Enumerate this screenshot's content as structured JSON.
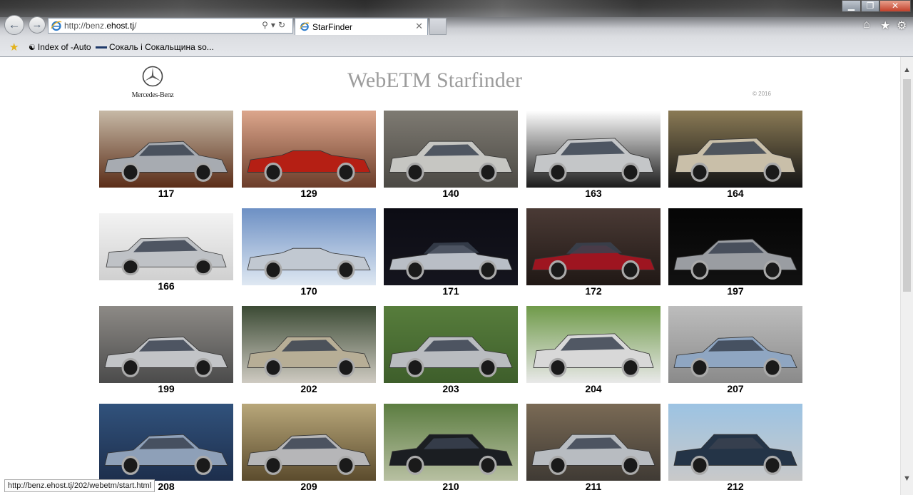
{
  "browser": {
    "address_url_prefix": "http://benz.",
    "address_url_host": "ehost.tj",
    "address_url_suffix": "/",
    "tab_title": "StarFinder",
    "favorites": [
      {
        "label": "Index of -Auto"
      },
      {
        "label": "Сокаль і Сокальщина  so..."
      }
    ],
    "status_url": "http://benz.ehost.tj/202/webetm/start.html"
  },
  "page": {
    "logo_text": "Mercedes-Benz",
    "title": "WebETM Starfinder",
    "copyright": "© 2016"
  },
  "models": [
    {
      "label": "117",
      "body": "coupe",
      "color": "#a7abb1",
      "bg": [
        "#c7b9a6",
        "#5b2d18"
      ]
    },
    {
      "label": "129",
      "body": "convertible",
      "color": "#b51f14",
      "bg": [
        "#dca68c",
        "#6b3d2a"
      ]
    },
    {
      "label": "140",
      "body": "sedan",
      "color": "#c6c6c2",
      "bg": [
        "#7e7a72",
        "#4b4944"
      ]
    },
    {
      "label": "163",
      "body": "suv",
      "color": "#c4c6c8",
      "bg": [
        "#ffffff",
        "#1b1b1b"
      ]
    },
    {
      "label": "164",
      "body": "suv",
      "color": "#c9bfa9",
      "bg": [
        "#8a7a55",
        "#141414"
      ]
    },
    {
      "label": "166",
      "body": "suv",
      "color": "#bfc2c6",
      "bg": [
        "#f3f3f3",
        "#d0d0d0"
      ]
    },
    {
      "label": "170",
      "body": "convertible",
      "color": "#c1c8d1",
      "bg": [
        "#6d90c4",
        "#dfe8f2"
      ]
    },
    {
      "label": "171",
      "body": "roadster",
      "color": "#b9bec6",
      "bg": [
        "#0c0c14",
        "#15151e"
      ]
    },
    {
      "label": "172",
      "body": "roadster",
      "color": "#9e1520",
      "bg": [
        "#4a3a35",
        "#201815"
      ]
    },
    {
      "label": "197",
      "body": "coupe",
      "color": "#9a9da2",
      "bg": [
        "#050505",
        "#111111"
      ]
    },
    {
      "label": "199",
      "body": "coupe",
      "color": "#c2c4c7",
      "bg": [
        "#8d8a86",
        "#4b4b4b"
      ]
    },
    {
      "label": "202",
      "body": "sedan",
      "color": "#b7ae96",
      "bg": [
        "#3b4a34",
        "#cfcbc2"
      ]
    },
    {
      "label": "203",
      "body": "sedan",
      "color": "#b9bcc0",
      "bg": [
        "#577d3c",
        "#3e5e2b"
      ]
    },
    {
      "label": "204",
      "body": "suv",
      "color": "#d8d8d8",
      "bg": [
        "#6f9a49",
        "#e9e9e9"
      ]
    },
    {
      "label": "207",
      "body": "coupe",
      "color": "#8fa6c2",
      "bg": [
        "#bdbdbd",
        "#8a8a8a"
      ]
    },
    {
      "label": "208",
      "body": "coupe",
      "color": "#8ea0b8",
      "bg": [
        "#31527c",
        "#1d2e4c"
      ]
    },
    {
      "label": "209",
      "body": "coupe",
      "color": "#b6b6b8",
      "bg": [
        "#b8a77a",
        "#5b4b2d"
      ]
    },
    {
      "label": "210",
      "body": "sedan",
      "color": "#1b1e22",
      "bg": [
        "#5c7d41",
        "#b8c0a2"
      ]
    },
    {
      "label": "211",
      "body": "sedan",
      "color": "#b8bcc1",
      "bg": [
        "#7a6a55",
        "#3f3a34"
      ]
    },
    {
      "label": "212",
      "body": "sedan",
      "color": "#243447",
      "bg": [
        "#9cc3e3",
        "#c9c9c9"
      ]
    }
  ]
}
